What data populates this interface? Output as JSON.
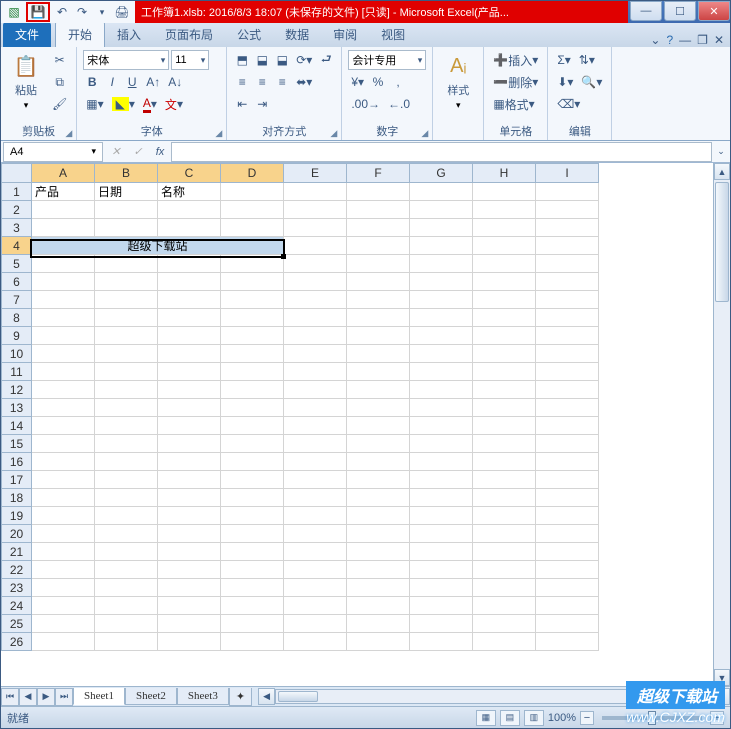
{
  "title_bar": {
    "text": "工作簿1.xlsb: 2016/8/3 18:07 (未保存的文件) [只读] - Microsoft Excel(产品..."
  },
  "tabs": {
    "file": "文件",
    "home": "开始",
    "insert": "插入",
    "page_layout": "页面布局",
    "formulas": "公式",
    "data": "数据",
    "review": "审阅",
    "view": "视图"
  },
  "ribbon": {
    "clipboard": {
      "label": "剪贴板",
      "paste": "粘贴"
    },
    "font": {
      "label": "字体",
      "name": "宋体",
      "size": "11",
      "bold": "B",
      "italic": "I",
      "underline": "U"
    },
    "alignment": {
      "label": "对齐方式"
    },
    "number": {
      "label": "数字",
      "format": "会计专用"
    },
    "styles": {
      "label": "样式",
      "btn": "样式"
    },
    "cells": {
      "label": "单元格",
      "insert": "插入",
      "delete": "删除",
      "format": "格式"
    },
    "editing": {
      "label": "编辑"
    }
  },
  "name_box": "A4",
  "columns": [
    "A",
    "B",
    "C",
    "D",
    "E",
    "F",
    "G",
    "H",
    "I"
  ],
  "rows_count": 26,
  "cells": {
    "A1": "产品",
    "B1": "日期",
    "C1": "名称",
    "merged_A4_D4": "超级下载站"
  },
  "selection": {
    "ref": "A4:D4",
    "selected_cols": [
      "A",
      "B",
      "C",
      "D"
    ],
    "selected_row": 4
  },
  "sheets": {
    "s1": "Sheet1",
    "s2": "Sheet2",
    "s3": "Sheet3"
  },
  "status": {
    "ready": "就绪",
    "zoom": "100%"
  },
  "watermark": {
    "line1": "超级下载站",
    "line2": "www.CJXZ.com"
  }
}
